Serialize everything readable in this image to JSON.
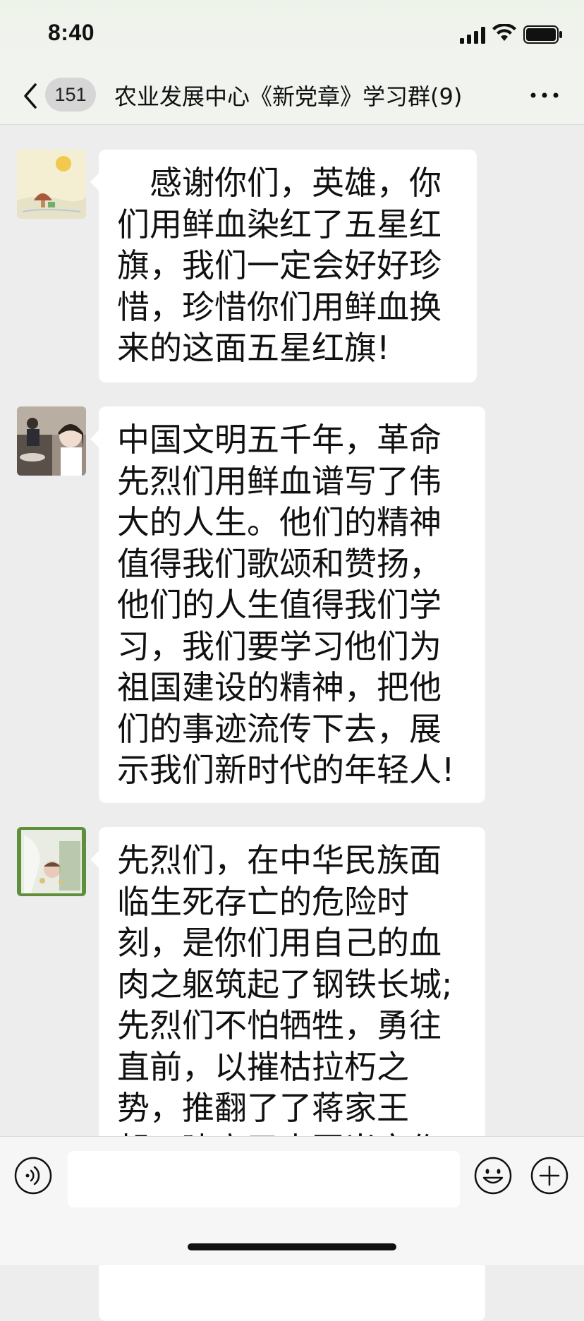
{
  "status_bar": {
    "time": "8:40",
    "icons": [
      "signal-icon",
      "wifi-icon",
      "battery-icon"
    ]
  },
  "nav": {
    "back_icon": "chevron-left-icon",
    "unread_count": "151",
    "title": "农业发展中心《新党章》学习群(9)",
    "more_icon": "more-dots-icon"
  },
  "messages": [
    {
      "avatar": "avatar-cartoon-sun",
      "text": "　感谢你们，英雄，你\n们用鲜血染红了五星红\n旗，我们一定会好好珍\n惜，珍惜你们用鲜血换\n来的这面五星红旗!"
    },
    {
      "avatar": "avatar-photo-woman",
      "text": "中国文明五千年，革命\n先烈们用鲜血谱写了伟\n大的人生。他们的精神\n值得我们歌颂和赞扬，\n他们的人生值得我们学\n习，我们要学习他们为\n祖国建设的精神，把他\n们的事迹流传下去，展\n示我们新时代的年轻人!"
    },
    {
      "avatar": "avatar-photo-green",
      "text": "先烈们，在中华民族面\n临生死存亡的危险时\n刻，是你们用自己的血\n肉之躯筑起了钢铁长城;\n先烈们不怕牺牲，勇往\n直前，以摧枯拉朽之\n势，推翻了了蒋家王\n朝，建立了中国当家作"
    }
  ],
  "input_bar": {
    "voice_icon": "voice-icon",
    "emoji_icon": "emoji-icon",
    "plus_icon": "plus-icon"
  },
  "colors": {
    "background": "#ededed",
    "bubble": "#ffffff",
    "nav_background": "#f1f3ef"
  }
}
